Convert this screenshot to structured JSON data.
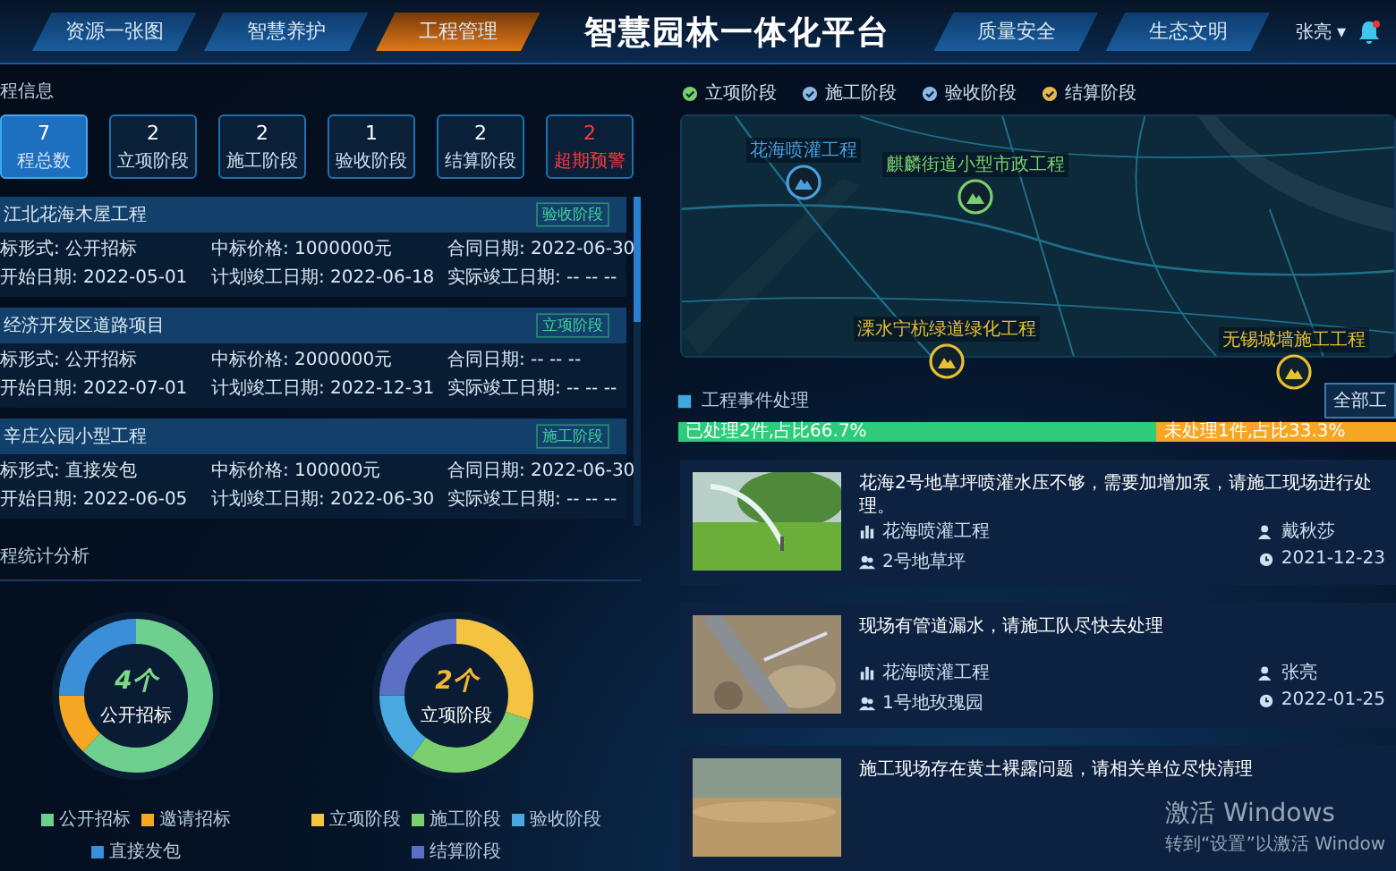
{
  "header": {
    "tabs_left": [
      {
        "label": "资源一张图",
        "selected": false
      },
      {
        "label": "智慧养护",
        "selected": false
      },
      {
        "label": "工程管理",
        "selected": true
      }
    ],
    "title": "智慧园林一体化平台",
    "tabs_right": [
      {
        "label": "质量安全",
        "selected": false
      },
      {
        "label": "生态文明",
        "selected": false
      }
    ],
    "user": "张亮",
    "user_caret": "▾"
  },
  "overview": {
    "title": "程信息",
    "stats": [
      {
        "value": "7",
        "label": "程总数",
        "selected": true,
        "warning": false
      },
      {
        "value": "2",
        "label": "立项阶段",
        "selected": false,
        "warning": false
      },
      {
        "value": "2",
        "label": "施工阶段",
        "selected": false,
        "warning": false
      },
      {
        "value": "1",
        "label": "验收阶段",
        "selected": false,
        "warning": false
      },
      {
        "value": "2",
        "label": "结算阶段",
        "selected": false,
        "warning": false
      },
      {
        "value": "2",
        "label": "超期预警",
        "selected": false,
        "warning": true
      }
    ],
    "projects": [
      {
        "name": "江北花海木屋工程",
        "stage": "验收阶段",
        "fields": [
          "标形式: 公开招标",
          "中标价格: 1000000元",
          "合同日期: 2022-06-30",
          "开始日期: 2022-05-01",
          "计划竣工日期: 2022-06-18",
          "实际竣工日期: -- -- --"
        ]
      },
      {
        "name": "经济开发区道路项目",
        "stage": "立项阶段",
        "fields": [
          "标形式: 公开招标",
          "中标价格: 2000000元",
          "合同日期: -- -- --",
          "开始日期: 2022-07-01",
          "计划竣工日期: 2022-12-31",
          "实际竣工日期: -- -- --"
        ]
      },
      {
        "name": "辛庄公园小型工程",
        "stage": "施工阶段",
        "fields": [
          "标形式: 直接发包",
          "中标价格: 100000元",
          "合同日期: 2022-06-30",
          "开始日期: 2022-06-05",
          "计划竣工日期: 2022-06-30",
          "实际竣工日期: -- -- --"
        ]
      }
    ]
  },
  "statistics": {
    "title": "程统计分析",
    "donuts": [
      {
        "center_value": "4个",
        "center_label": "公开招标",
        "color": "#7dd88a",
        "legend": [
          {
            "label": "公开招标",
            "color": "#6fcf8f"
          },
          {
            "label": "邀请招标",
            "color": "#f5a623"
          },
          {
            "label": "直接发包",
            "color": "#3a8fd8"
          }
        ]
      },
      {
        "center_value": "2个",
        "center_label": "立项阶段",
        "color": "#f5b630",
        "legend": [
          {
            "label": "立项阶段",
            "color": "#f5c342"
          },
          {
            "label": "施工阶段",
            "color": "#7ccf6e"
          },
          {
            "label": "验收阶段",
            "color": "#4aa8e0"
          },
          {
            "label": "结算阶段",
            "color": "#5b6fc4"
          }
        ]
      }
    ]
  },
  "map": {
    "legend": [
      {
        "label": "立项阶段",
        "color": "#7ccf6e"
      },
      {
        "label": "施工阶段",
        "color": "#8fb8e8"
      },
      {
        "label": "验收阶段",
        "color": "#8fb8e8"
      },
      {
        "label": "结算阶段",
        "color": "#e8b84a"
      }
    ],
    "markers": [
      {
        "label": "花海喷灌工程",
        "color": "#4a9fe0"
      },
      {
        "label": "麒麟街道小型市政工程",
        "color": "#7ccf6e"
      },
      {
        "label": "溧水宁杭绿道绿化工程",
        "color": "#e8c030"
      },
      {
        "label": "无锡城墙施工工程",
        "color": "#e8c030"
      }
    ]
  },
  "events": {
    "title": "工程事件处理",
    "all_button": "全部工",
    "progress": {
      "level": 0.667,
      "done_text": "已处理2件,占比66.7%",
      "todo_text": "未处理1件,占比33.3%"
    },
    "items": [
      {
        "kind": "sprinkler",
        "text": "花海2号地草坪喷灌水压不够，需要加增加泵，请施工现场进行处理。",
        "project": "花海喷灌工程",
        "location": "2号地草坪",
        "person": "戴秋莎",
        "date": "2021-12-23"
      },
      {
        "kind": "pipe",
        "text": "现场有管道漏水，请施工队尽快去处理",
        "project": "花海喷灌工程",
        "location": "1号地玫瑰园",
        "person": "张亮",
        "date": "2022-01-25"
      },
      {
        "kind": "soil",
        "text": "施工现场存在黄土裸露问题，请相关单位尽快清理"
      }
    ]
  },
  "os_notice": {
    "title": "激活 Windows",
    "text": "转到“设置”以激活 Window"
  }
}
